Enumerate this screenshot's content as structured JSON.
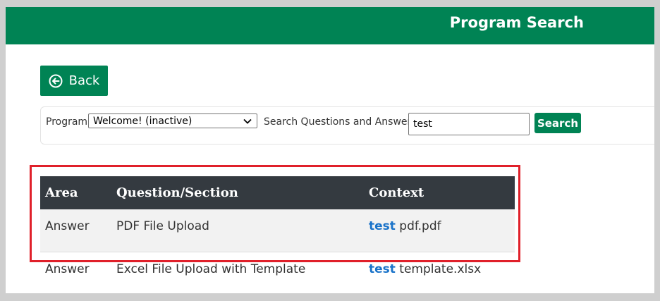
{
  "header": {
    "title": "Program Search"
  },
  "back_button": {
    "label": "Back"
  },
  "search_bar": {
    "program_label": "Program",
    "program_selected": "Welcome! (inactive)",
    "qa_label": "Search Questions and Answers",
    "query_value": "test",
    "search_label": "Search"
  },
  "table": {
    "headers": {
      "area": "Area",
      "question": "Question/Section",
      "context": "Context"
    },
    "rows": [
      {
        "area": "Answer",
        "question": "PDF File Upload",
        "match": "test",
        "rest": " pdf.pdf"
      },
      {
        "area": "Answer",
        "question": "Excel File Upload with Template",
        "match": "test",
        "rest": " template.xlsx"
      }
    ]
  },
  "colors": {
    "brand_green": "#008354",
    "table_header": "#343a40",
    "match_blue": "#1a73c9",
    "annotation_red": "#e0202a"
  }
}
